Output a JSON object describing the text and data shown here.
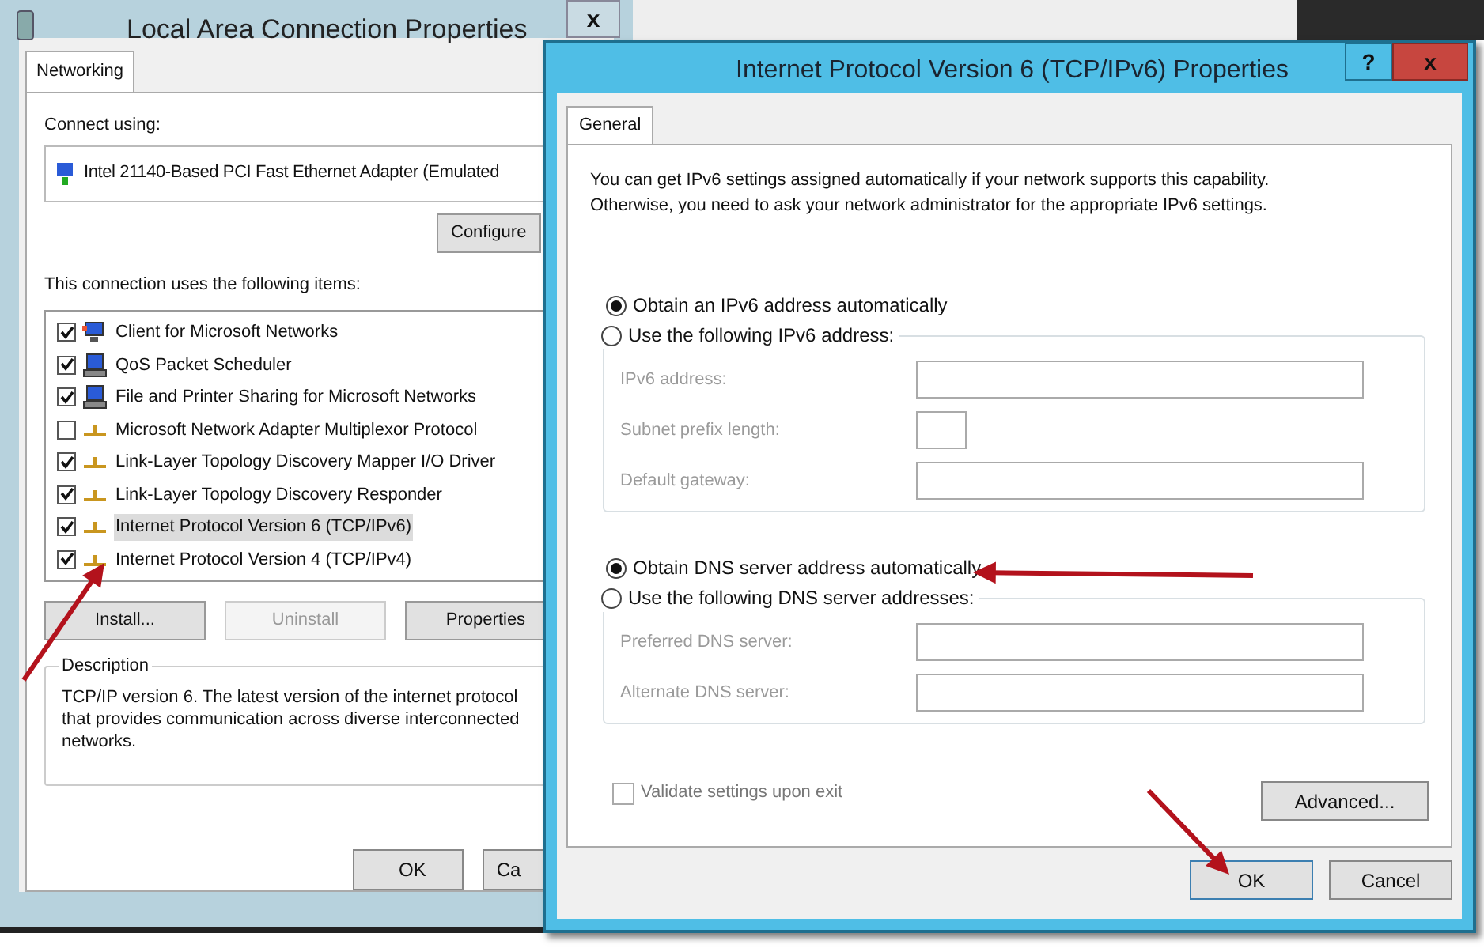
{
  "back_window": {
    "title": "Local Area Connection Properties",
    "close": "x",
    "tabs": [
      {
        "label": "Networking",
        "selected": true
      }
    ],
    "connect_using_label": "Connect using:",
    "adapter": "Intel 21140-Based PCI Fast Ethernet Adapter (Emulated",
    "configure_button": "Configure",
    "items_label": "This connection uses the following items:",
    "items": [
      {
        "label": "Client for Microsoft Networks",
        "checked": true,
        "selected": false,
        "kind": "client"
      },
      {
        "label": "QoS Packet Scheduler",
        "checked": true,
        "selected": false,
        "kind": "service"
      },
      {
        "label": "File and Printer Sharing for Microsoft Networks",
        "checked": true,
        "selected": false,
        "kind": "service"
      },
      {
        "label": "Microsoft Network Adapter Multiplexor Protocol",
        "checked": false,
        "selected": false,
        "kind": "protocol"
      },
      {
        "label": "Link-Layer Topology Discovery Mapper I/O Driver",
        "checked": true,
        "selected": false,
        "kind": "protocol"
      },
      {
        "label": "Link-Layer Topology Discovery Responder",
        "checked": true,
        "selected": false,
        "kind": "protocol"
      },
      {
        "label": "Internet Protocol Version 6 (TCP/IPv6)",
        "checked": true,
        "selected": true,
        "kind": "protocol"
      },
      {
        "label": "Internet Protocol Version 4 (TCP/IPv4)",
        "checked": true,
        "selected": false,
        "kind": "protocol"
      }
    ],
    "item_buttons": [
      {
        "label": "Install...",
        "disabled": false
      },
      {
        "label": "Uninstall",
        "disabled": true
      },
      {
        "label": "Properties",
        "disabled": false
      }
    ],
    "description_label": "Description",
    "description": "TCP/IP version 6. The latest version of the internet protocol\nthat provides communication across diverse interconnected\nnetworks.",
    "footer_buttons": [
      "OK",
      "Ca"
    ]
  },
  "dialog": {
    "title": "Internet Protocol Version 6 (TCP/IPv6) Properties",
    "help": "?",
    "close": "x",
    "tabs": [
      {
        "label": "General",
        "selected": true
      }
    ],
    "intro": "You can get IPv6 settings assigned automatically if your network supports this capability.\nOtherwise, you need to ask your network administrator for the appropriate IPv6 settings.",
    "sections": [
      {
        "auto_option": {
          "label": "Obtain an IPv6 address automatically",
          "selected": true
        },
        "manual_option": {
          "label": "Use the following IPv6 address:",
          "selected": false
        },
        "fields": [
          {
            "label": "IPv6 address:",
            "kind": "wide"
          },
          {
            "label": "Subnet prefix length:",
            "kind": "short"
          },
          {
            "label": "Default gateway:",
            "kind": "wide"
          }
        ]
      },
      {
        "auto_option": {
          "label": "Obtain DNS server address automatically",
          "selected": true
        },
        "manual_option": {
          "label": "Use the following DNS server addresses:",
          "selected": false
        },
        "fields": [
          {
            "label": "Preferred DNS server:",
            "kind": "wide"
          },
          {
            "label": "Alternate DNS server:",
            "kind": "wide"
          }
        ]
      }
    ],
    "validate": {
      "label": "Validate settings upon exit",
      "checked": false
    },
    "advanced_button": "Advanced...",
    "footer_buttons": [
      {
        "label": "OK",
        "default": true
      },
      {
        "label": "Cancel",
        "default": false
      }
    ]
  }
}
